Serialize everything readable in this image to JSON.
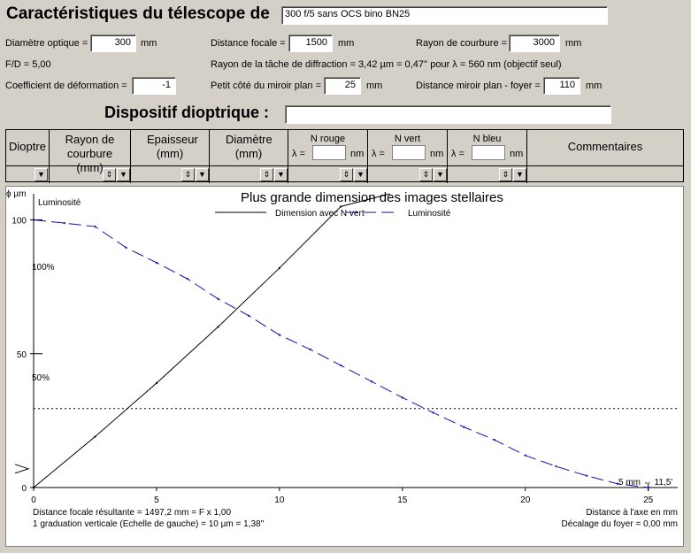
{
  "header": {
    "title": "Caractéristiques du télescope de",
    "telescope_name": "300 f/5 sans OCS bino BN25"
  },
  "params": {
    "diam_label": "Diamètre optique =",
    "diam_value": "300",
    "diam_unit": "mm",
    "focal_label": "Distance focale =",
    "focal_value": "1500",
    "focal_unit": "mm",
    "rayon_label": "Rayon de courbure =",
    "rayon_value": "3000",
    "rayon_unit": "mm",
    "fd_text": "F/D = 5,00",
    "diffraction_text": "Rayon de la tâche de diffraction = 3,42 µm = 0,47'' pour λ = 560 nm (objectif seul)",
    "coef_label": "Coefficient de déformation =",
    "coef_value": "-1",
    "petit_label": "Petit côté du miroir plan =",
    "petit_value": "25",
    "petit_unit": "mm",
    "dist_label": "Distance miroir plan - foyer =",
    "dist_value": "110",
    "dist_unit": "mm"
  },
  "dispositif": {
    "label": "Dispositif dioptrique :",
    "value": ""
  },
  "table": {
    "col_dioptre": "Dioptre",
    "col_rayon": "Rayon de courbure (mm)",
    "col_epaisseur": "Epaisseur (mm)",
    "col_diametre": "Diamètre (mm)",
    "col_nrouge": "N rouge",
    "col_nvert": "N vert",
    "col_nbleu": "N bleu",
    "col_comment": "Commentaires",
    "lambda_label": "λ =",
    "nm": "nm"
  },
  "chart_data": {
    "type": "line",
    "title": "Plus grande dimension des images stellaires",
    "left_axis_label": "ϕ µm",
    "lum_label": "Luminosité",
    "lum_100": "100%",
    "lum_50": "50%",
    "xlim": [
      0,
      26.2
    ],
    "ylim": [
      0,
      120
    ],
    "x_ticks": [
      0,
      5,
      10,
      15,
      20,
      25
    ],
    "y_ticks": [
      0,
      50,
      100
    ],
    "series": [
      {
        "name": "Dimension avec N vert",
        "x": [
          0,
          2.5,
          5,
          7.5,
          10,
          12.5,
          14.5
        ],
        "y": [
          0,
          19,
          39,
          60,
          82,
          105,
          125
        ]
      },
      {
        "name": "Luminosité",
        "x": [
          0,
          1.25,
          2.5,
          3.75,
          5,
          6.25,
          7.5,
          8.75,
          10,
          11.25,
          12.5,
          13.75,
          15,
          16.25,
          17.5,
          18.75,
          20,
          21.25,
          22.5,
          23.75,
          25
        ],
        "y": [
          100,
          98.8,
          97.5,
          89.7,
          84,
          78,
          70.5,
          64.2,
          57,
          51.6,
          45.6,
          39.6,
          33.6,
          28,
          22.6,
          17.8,
          12,
          7.9,
          4.4,
          1.4,
          0
        ]
      }
    ],
    "reference_line_y": 29.5,
    "marker_y": 7,
    "annotation_right": "5 mm ⇔ 11,5'",
    "bottom_left_1": "Distance focale résultante = 1497,2 mm = F x 1,00",
    "bottom_left_2": "1 graduation verticale (Echelle de gauche) = 10 µm = 1,38''",
    "bottom_right_1": "Distance à l'axe en mm",
    "bottom_right_2": "Décalage du foyer = 0,00 mm"
  }
}
